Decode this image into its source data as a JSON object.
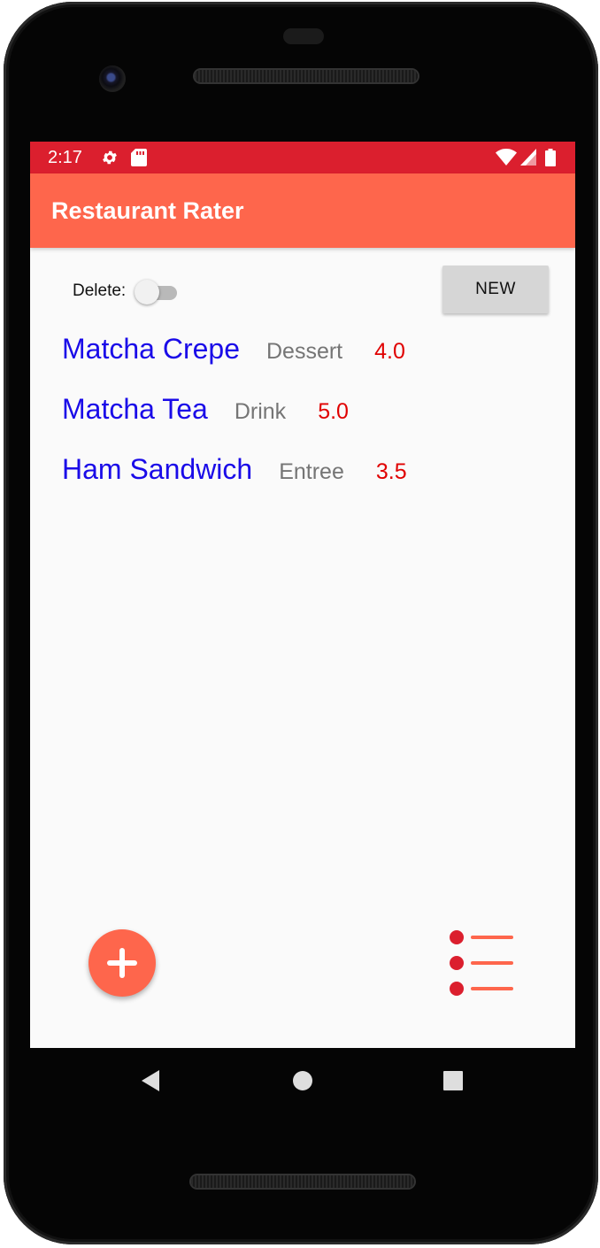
{
  "status_bar": {
    "time": "2:17",
    "icons": [
      "settings-icon",
      "sd-card-icon",
      "wifi-icon",
      "signal-icon",
      "battery-icon"
    ],
    "background_color": "#db1f2e"
  },
  "app_bar": {
    "title": "Restaurant Rater",
    "background_color": "#fe664c"
  },
  "controls": {
    "delete_label": "Delete:",
    "delete_toggle_on": false,
    "new_button_label": "NEW"
  },
  "restaurants": [
    {
      "name": "Matcha Crepe",
      "type": "Dessert",
      "rating": "4.0"
    },
    {
      "name": "Matcha Tea",
      "type": "Drink",
      "rating": "5.0"
    },
    {
      "name": "Ham Sandwich",
      "type": "Entree",
      "rating": "3.5"
    }
  ],
  "bottom_actions": {
    "add_icon": "plus-icon",
    "list_icon": "list-icon"
  },
  "nav_bar": {
    "icons": [
      "back-icon",
      "home-icon",
      "recents-icon"
    ]
  },
  "colors": {
    "name": "#1a0be8",
    "type": "#757575",
    "rating": "#e00000",
    "accent": "#fe664c"
  }
}
